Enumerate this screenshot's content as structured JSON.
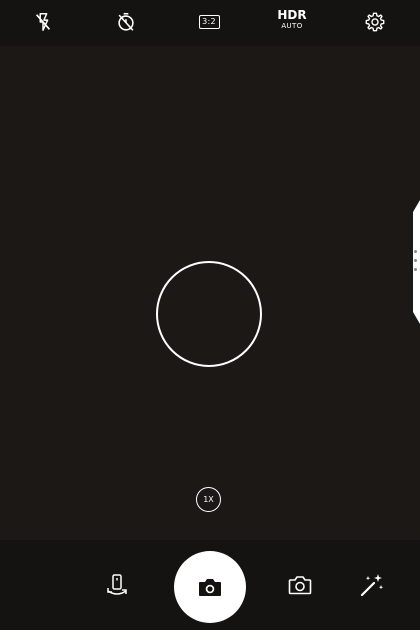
{
  "top_bar": {
    "flash": {
      "icon": "flash-off-icon"
    },
    "timer": {
      "icon": "timer-off-icon"
    },
    "aspect_ratio": {
      "label": "3:2",
      "icon": "aspect-ratio-icon"
    },
    "hdr": {
      "title": "HDR",
      "mode": "AUTO"
    },
    "settings": {
      "icon": "gear-icon"
    }
  },
  "viewfinder": {
    "focus_indicator": "focus-ring",
    "zoom_label": "1X",
    "side_panel": {
      "icon": "side-panel-handle-icon"
    }
  },
  "bottom_bar": {
    "switch_camera": {
      "icon": "switch-camera-icon"
    },
    "shutter": {
      "icon": "camera-icon"
    },
    "mode": {
      "icon": "photo-mode-icon"
    },
    "effects": {
      "icon": "magic-wand-icon"
    }
  },
  "colors": {
    "viewfinder_bg": "#1b1815",
    "bar_bg": "#141312",
    "icon": "#ffffff",
    "shutter": "#ffffff"
  }
}
